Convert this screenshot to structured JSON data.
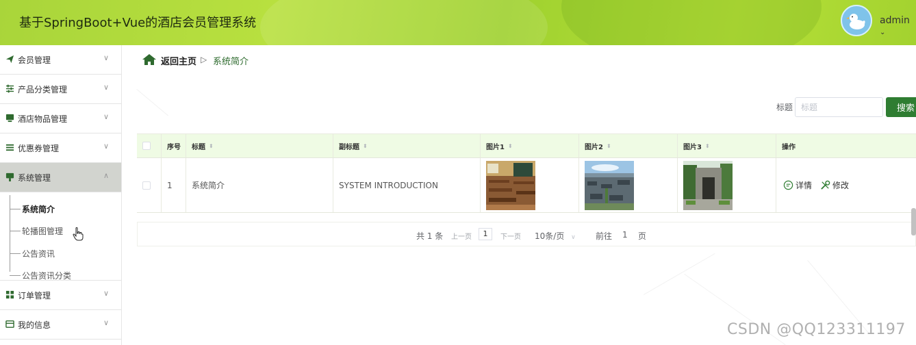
{
  "header": {
    "title": "基于SpringBoot+Vue的酒店会员管理系统",
    "user": "admin",
    "user_chevron": "⌄"
  },
  "sidebar": {
    "items": [
      {
        "label": "会员管理",
        "icon": "paper-plane-icon"
      },
      {
        "label": "产品分类管理",
        "icon": "sliders-icon"
      },
      {
        "label": "酒店物品管理",
        "icon": "monitor-icon"
      },
      {
        "label": "优惠券管理",
        "icon": "list-icon"
      },
      {
        "label": "系统管理",
        "icon": "marker-icon"
      },
      {
        "label": "订单管理",
        "icon": "grid-icon"
      },
      {
        "label": "我的信息",
        "icon": "card-icon"
      }
    ],
    "submenu": [
      {
        "label": "系统简介"
      },
      {
        "label": "轮播图管理"
      },
      {
        "label": "公告资讯"
      },
      {
        "label": "公告资讯分类"
      }
    ],
    "active_index": 4,
    "current_sub_index": 0
  },
  "breadcrumb": {
    "home": "返回主页",
    "separator": "▷",
    "current": "系统简介"
  },
  "search": {
    "label": "标题",
    "placeholder": "标题",
    "value": "",
    "button": "搜索"
  },
  "table": {
    "columns": [
      "序号",
      "标题",
      "副标题",
      "图片1",
      "图片2",
      "图片3",
      "操作"
    ],
    "rows": [
      {
        "index": "1",
        "title": "系统简介",
        "subtitle": "SYSTEM INTRODUCTION",
        "images": [
          "classroom",
          "old-town-rooftops",
          "stone-archway"
        ],
        "actions": [
          "详情",
          "修改"
        ]
      }
    ]
  },
  "pagination": {
    "total": "共 1 条",
    "prev": "上一页",
    "page": "1",
    "next": "下一页",
    "page_size": "10条/页",
    "goto_label": "前往",
    "goto_value": "1",
    "goto_suffix": "页"
  },
  "watermark": "CSDN @QQ123311197",
  "colors": {
    "header": "#aad83a",
    "accent_green": "#2f7d32",
    "table_header_bg": "#effbe4",
    "active_menu_bg": "#d2d4cf"
  }
}
